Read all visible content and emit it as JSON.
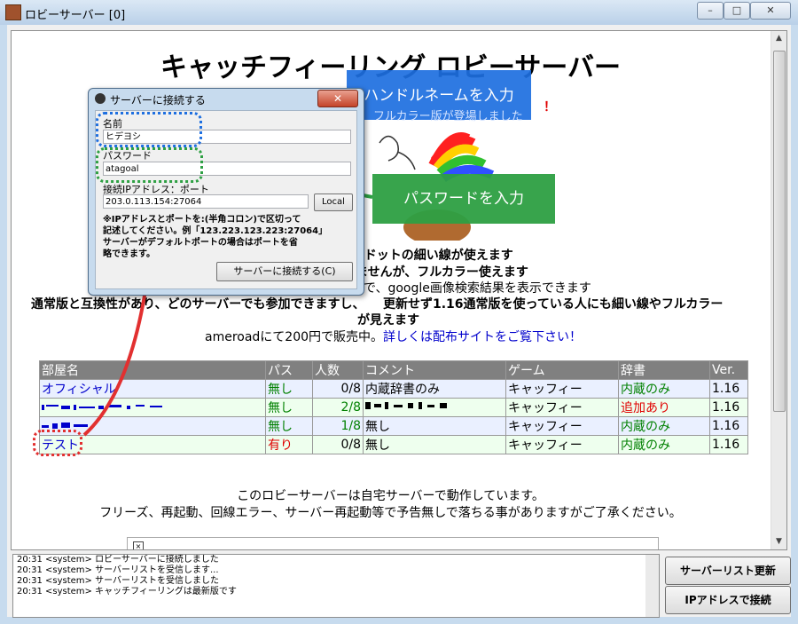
{
  "window": {
    "title": "ロビーサーバー [0]",
    "buttons": [
      "–",
      "□",
      "✕"
    ]
  },
  "page": {
    "title": "キャッチフィーリング ロビーサーバー",
    "announce_tail": "！",
    "features": [
      "1ドットの細い線が使えます",
      "ませんが、フルカラー使えます",
      "で、google画像検索結果を表示できます"
    ],
    "compat_a": "通常版と互換性があり、どのサーバーでも参加できますし、",
    "compat_b": "更新せず1.16通常版を使っている人にも細い線やフルカラー",
    "compat_c": "が見えます",
    "sale_text": "ameroadにて200円で販売中。",
    "sale_link": "詳しくは配布サイトをご覧下さい！"
  },
  "rooms": {
    "headers": [
      "部屋名",
      "パス",
      "人数",
      "コメント",
      "ゲーム",
      "辞書",
      "Ver."
    ],
    "rows": [
      {
        "name": "オフィシャル",
        "pass": "無し",
        "count": "0/8",
        "comment": "内蔵辞書のみ",
        "game": "キャッフィー",
        "dict": "内蔵のみ",
        "ver": "1.16"
      },
      {
        "name": "",
        "pass": "無し",
        "count": "2/8",
        "comment": "",
        "game": "キャッフィー",
        "dict": "追加あり",
        "ver": "1.16"
      },
      {
        "name": "",
        "pass": "無し",
        "count": "1/8",
        "comment": "無し",
        "game": "キャッフィー",
        "dict": "内蔵のみ",
        "ver": "1.16"
      },
      {
        "name": "テスト",
        "pass": "有り",
        "count": "0/8",
        "comment": "無し",
        "game": "キャッフィー",
        "dict": "内蔵のみ",
        "ver": "1.16"
      }
    ]
  },
  "notice": {
    "line1": "このロビーサーバーは自宅サーバーで動作しています。",
    "line2": "フリーズ、再起動、回線エラー、サーバー再起動等で予告無しで落ちる事がありますがご了承ください。"
  },
  "log": [
    "20:31 <system> ロビーサーバーに接続しました",
    "20:31 <system> サーバーリストを受信します...",
    "20:31 <system> サーバーリストを受信しました",
    "20:31 <system> キャッチフィーリングは最新版です"
  ],
  "buttons": {
    "refresh": "サーバーリスト更新",
    "ip_connect": "IPアドレスで接続"
  },
  "dialog": {
    "title": "サーバーに接続する",
    "close": "✕",
    "name_label": "名前",
    "name_value": "ヒデヨシ",
    "pass_label": "パスワード",
    "pass_value": "atagoal",
    "ip_label": "接続IPアドレス：ポート",
    "ip_value": "203.0.113.154:27064",
    "local_button": "Local",
    "hint": [
      "※IPアドレスとポートを:(半角コロン)で区切って",
      "記述してください。例「123.223.123.223:27064」",
      "サーバーがデフォルトポートの場合はポートを省",
      "略できます。"
    ],
    "connect_button": "サーバーに接続する(C)"
  },
  "annotations": {
    "handle": "ハンドルネームを入力",
    "password": "パスワードを入力",
    "bg_text": "フルカラー版が登場しました",
    "colors": {
      "blue": "#1e6fe0",
      "green": "#2ea043",
      "red": "#e23030"
    }
  }
}
